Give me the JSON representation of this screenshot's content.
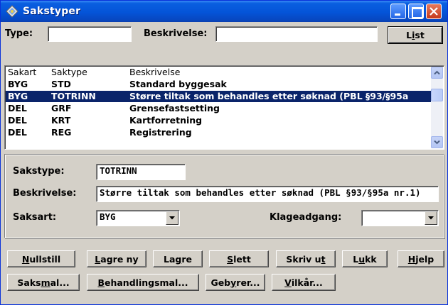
{
  "window": {
    "title": "Sakstyper"
  },
  "search": {
    "type_label": "Type:",
    "type_value": "",
    "description_label": "Beskrivelse:",
    "description_value": "",
    "list_button": {
      "pre": "L",
      "u": "i",
      "post": "st"
    }
  },
  "list": {
    "headers": [
      "Sakart",
      "Saktype",
      "Beskrivelse"
    ],
    "rows": [
      {
        "sakart": "BYG",
        "saktype": "STD",
        "beskrivelse": "Standard byggesak"
      },
      {
        "sakart": "BYG",
        "saktype": "TOTRINN",
        "beskrivelse": "Større tiltak som behandles etter søknad (PBL §93/§95a"
      },
      {
        "sakart": "DEL",
        "saktype": "GRF",
        "beskrivelse": "Grensefastsetting"
      },
      {
        "sakart": "DEL",
        "saktype": "KRT",
        "beskrivelse": "Kartforretning"
      },
      {
        "sakart": "DEL",
        "saktype": "REG",
        "beskrivelse": "Registrering"
      }
    ],
    "selected_index": 1
  },
  "detail": {
    "sakstype_label": "Sakstype:",
    "sakstype_value": "TOTRINN",
    "beskrivelse_label": "Beskrivelse:",
    "beskrivelse_value": "Større tiltak som behandles etter søknad (PBL §93/§95a nr.1)",
    "saksart_label": "Saksart:",
    "saksart_value": "BYG",
    "klageadgang_label": "Klageadgang:",
    "klageadgang_value": ""
  },
  "buttons": {
    "nullstill": {
      "pre": "",
      "u": "N",
      "post": "ullstill"
    },
    "lagre_ny": {
      "pre": "",
      "u": "L",
      "post": "agre ny"
    },
    "lagre": {
      "pre": "La",
      "u": "g",
      "post": "re"
    },
    "slett": {
      "pre": "",
      "u": "S",
      "post": "lett"
    },
    "skriv_ut": {
      "pre": "Skriv u",
      "u": "t",
      "post": ""
    },
    "lukk": {
      "pre": "L",
      "u": "u",
      "post": "kk"
    },
    "hjelp": {
      "pre": "",
      "u": "H",
      "post": "jelp"
    },
    "saksmal": {
      "pre": "Saks",
      "u": "m",
      "post": "al..."
    },
    "behandlingsmal": {
      "pre": "",
      "u": "B",
      "post": "ehandlingsmal..."
    },
    "gebyrer": {
      "pre": "Geb",
      "u": "y",
      "post": "rer..."
    },
    "vilkar": {
      "pre": "",
      "u": "V",
      "post": "ilkår..."
    }
  }
}
